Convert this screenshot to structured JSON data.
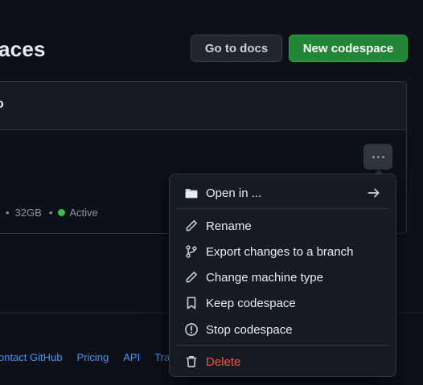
{
  "header": {
    "title": "aces",
    "docs_label": "Go to docs",
    "new_label": "New codespace"
  },
  "card": {
    "header_text": "o",
    "meta": {
      "storage": "32GB",
      "status": "Active"
    }
  },
  "menu": {
    "open_in": "Open in ...",
    "rename": "Rename",
    "export": "Export changes to a branch",
    "change_machine": "Change machine type",
    "keep": "Keep codespace",
    "stop": "Stop codespace",
    "delete": "Delete"
  },
  "footer": {
    "links": [
      "ontact GitHub",
      "Pricing",
      "API",
      "Tra"
    ]
  },
  "colors": {
    "primary_button": "#238636",
    "danger": "#f85149",
    "status_active": "#3fb950",
    "link": "#4493f8"
  }
}
